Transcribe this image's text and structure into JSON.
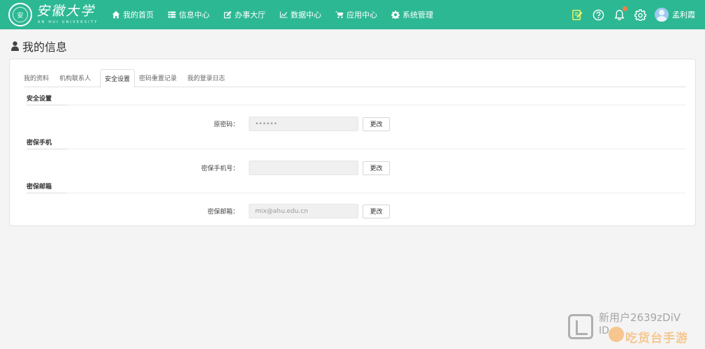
{
  "header": {
    "logo_text": "安",
    "brand": "安徽大学",
    "brand_sub": "AN HUI UNIVERSITY",
    "nav": [
      {
        "label": "我的首页",
        "icon": "home-icon"
      },
      {
        "label": "信息中心",
        "icon": "list-icon"
      },
      {
        "label": "办事大厅",
        "icon": "edit-icon"
      },
      {
        "label": "数据中心",
        "icon": "chart-icon"
      },
      {
        "label": "应用中心",
        "icon": "cart-icon"
      },
      {
        "label": "系统管理",
        "icon": "gear-icon"
      }
    ],
    "username": "孟利霞"
  },
  "page": {
    "title": "我的信息"
  },
  "tabs": [
    {
      "label": "我的资料",
      "active": false
    },
    {
      "label": "机构联系人",
      "active": false
    },
    {
      "label": "安全设置",
      "active": true
    },
    {
      "label": "密码重置记录",
      "active": false
    },
    {
      "label": "我的登录日志",
      "active": false
    }
  ],
  "sections": {
    "security": {
      "title": "安全设置",
      "label": "原密码：",
      "value": "••••••",
      "button": "更改"
    },
    "phone": {
      "title": "密保手机",
      "label": "密保手机号：",
      "value": "",
      "button": "更改"
    },
    "email": {
      "title": "密保邮箱",
      "label": "密保邮箱：",
      "value": "mix@ahu.edu.cn",
      "button": "更改"
    }
  },
  "watermark": {
    "line1": "新用户2639zDiV",
    "line2": "ID",
    "brand": "吃货台手游"
  },
  "colors": {
    "header_bg": "#2db894",
    "notification_dot": "#f07f4a",
    "edit_icon": "#e8f56a"
  }
}
